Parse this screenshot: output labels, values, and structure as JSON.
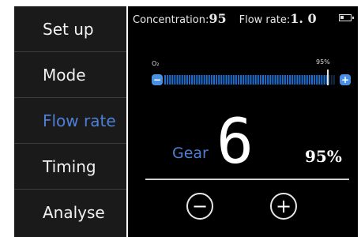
{
  "sidebar": {
    "items": [
      {
        "label": "Set up"
      },
      {
        "label": "Mode"
      },
      {
        "label": "Flow rate"
      },
      {
        "label": "Timing"
      },
      {
        "label": "Analyse"
      }
    ]
  },
  "status": {
    "concentration_label": "Concentration:",
    "concentration_value": "95",
    "flow_label": "Flow rate:",
    "flow_value": "1. 0"
  },
  "bar": {
    "left_label": "O₂",
    "right_label": "95%",
    "fill_fraction": 0.95,
    "minus_symbol": "−",
    "plus_symbol": "+"
  },
  "gear": {
    "label": "Gear",
    "value": "6",
    "percent": "95%"
  },
  "controls": {
    "minus": "−",
    "plus": "+"
  },
  "colors": {
    "background": "#000000",
    "sidebar": "#1a1a1a",
    "accent": "#4f7fd6",
    "bar": "#1f6fd1",
    "text": "#ffffff"
  },
  "icons": {
    "battery": "battery-icon",
    "minus": "minus-icon",
    "plus": "plus-icon"
  }
}
